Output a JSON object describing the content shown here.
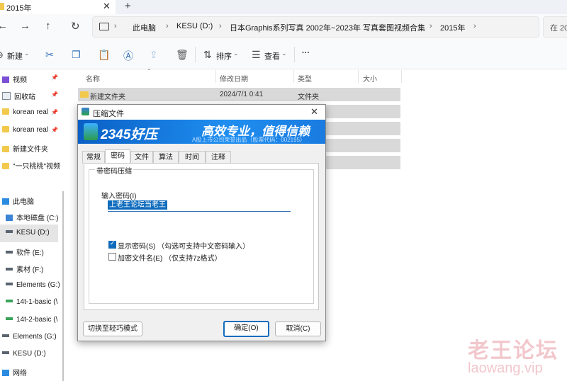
{
  "window": {
    "tab_title": "2015年",
    "tab_close": "✕",
    "new_tab": "+"
  },
  "nav": {
    "back": "←",
    "forward": "→",
    "up": "↑",
    "refresh": "↻",
    "breadcrumbs": [
      "此电脑",
      "KESU (D:)",
      "日本Graphis系列写真 2002年~2023年 写真套图视频合集",
      "2015年"
    ],
    "search_placeholder": "在 20"
  },
  "commands": {
    "new_label": "新建",
    "sort_label": "排序",
    "view_label": "查看",
    "more": "···"
  },
  "sidebar": {
    "quick_items": [
      {
        "label": "视频",
        "icon": "video-icon",
        "pinned": true
      },
      {
        "label": "回收站",
        "icon": "recycle-bin-icon",
        "pinned": true
      },
      {
        "label": "korean real",
        "icon": "folder-icon",
        "pinned": true
      },
      {
        "label": "korean real",
        "icon": "folder-icon",
        "pinned": true
      },
      {
        "label": "新建文件夹",
        "icon": "folder-icon",
        "pinned": false
      },
      {
        "label": "\"一只桃桃\"视频",
        "icon": "folder-icon",
        "pinned": false
      }
    ],
    "this_pc": "此电脑",
    "drives": [
      {
        "label": "本地磁盘 (C:)",
        "icon": "windows-drive-icon"
      },
      {
        "label": "KESU (D:)",
        "icon": "drive-icon",
        "selected": true
      },
      {
        "label": "软件 (E:)",
        "icon": "drive-icon"
      },
      {
        "label": "素材 (F:)",
        "icon": "drive-icon"
      },
      {
        "label": "Elements (G:)",
        "icon": "drive-icon"
      },
      {
        "label": "14t-1-basic (\\",
        "icon": "network-drive-icon"
      },
      {
        "label": "14t-2-basic (\\",
        "icon": "network-drive-icon"
      },
      {
        "label": "Elements (G:)",
        "icon": "drive-icon"
      },
      {
        "label": "KESU (D:)",
        "icon": "drive-icon"
      },
      {
        "label": "网络",
        "icon": "network-icon"
      }
    ]
  },
  "file_list": {
    "columns": [
      "名称",
      "修改日期",
      "类型",
      "大小"
    ],
    "rows": [
      {
        "name": "新建文件夹",
        "date": "2024/7/1 0:41",
        "type": "文件夹",
        "size": ""
      }
    ]
  },
  "dialog": {
    "title": "压缩文件",
    "close": "✕",
    "brand": "2345好压",
    "slogan": "高效专业，值得信赖",
    "banner_sub": "A股上市公司荣誉出品（股票代码：002195）",
    "tabs": [
      "常规",
      "密码",
      "文件",
      "算法",
      "时间",
      "注释"
    ],
    "selected_tab": "密码",
    "group_label": "带密码压缩",
    "password_label": "输入密码(I)",
    "password_value": "上老王论坛当老王",
    "show_password_label": "显示密码(S)  （勾选可支持中文密码输入）",
    "show_password_checked": true,
    "encrypt_names_label": "加密文件名(E)  （仅支持7z格式）",
    "encrypt_names_checked": false,
    "switch_mode_button": "切换至轻巧模式",
    "ok_button": "确定(O)",
    "cancel_button": "取消(C)"
  },
  "watermark": {
    "line1": "老王论坛",
    "line2": "laowang.vip"
  }
}
